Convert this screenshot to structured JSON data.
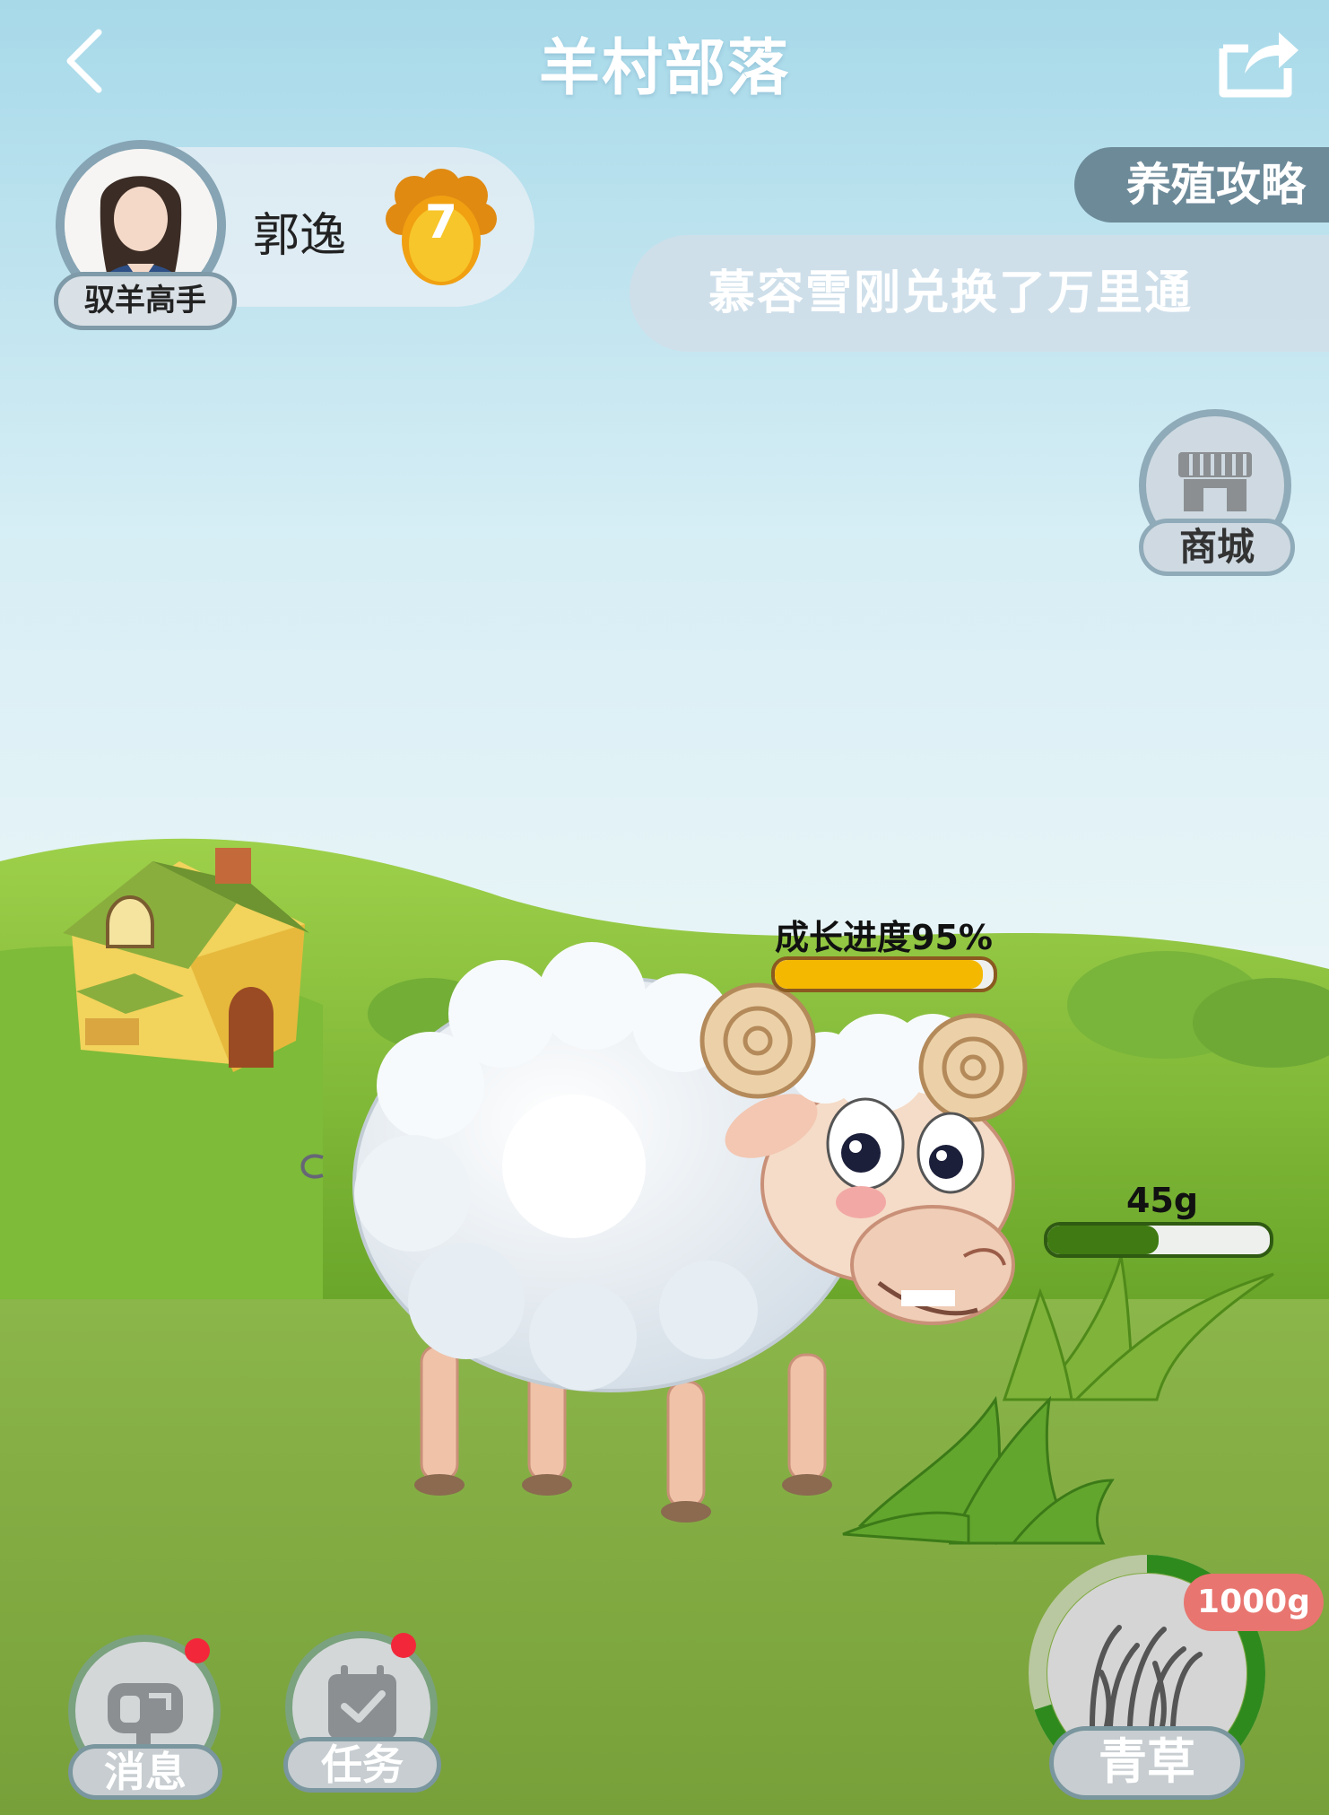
{
  "header": {
    "title": "羊村部落",
    "back_icon": "chevron-left-icon",
    "share_icon": "share-icon"
  },
  "profile": {
    "username": "郭逸",
    "title_badge": "驭羊高手",
    "level": "7"
  },
  "guide": {
    "label": "养殖攻略"
  },
  "ticker": {
    "message": "慕容雪刚兑换了万里通"
  },
  "shop": {
    "label": "商城",
    "icon": "store-icon"
  },
  "sheep": {
    "growth_label": "成长进度95%",
    "growth_fraction": 0.95
  },
  "feed": {
    "amount_label": "45g",
    "fraction": 0.5
  },
  "bottom": {
    "messages_label": "消息",
    "tasks_label": "任务",
    "grass_label": "青草",
    "grass_amount": "1000g",
    "grass_fraction": 0.7
  },
  "colors": {
    "sky_top": "#a9dcea",
    "grass": "#7fb23a",
    "growth_bar": "#f5b800",
    "feed_bar": "#3f7a12",
    "notify": "#f2283a",
    "grass_ring": "#2f8a1e"
  }
}
